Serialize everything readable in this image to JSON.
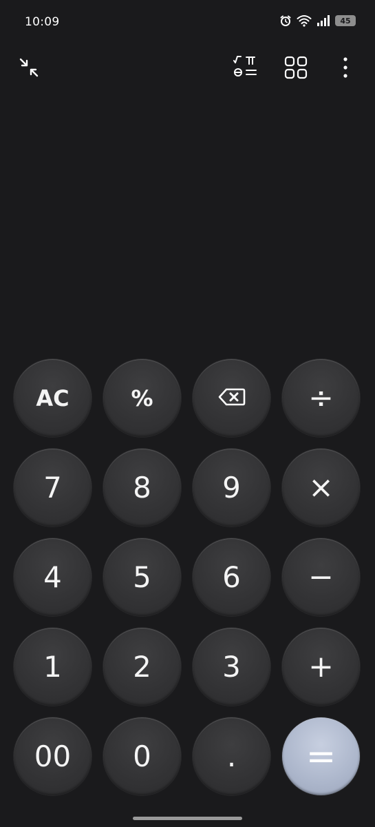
{
  "status_bar": {
    "time": "10:09",
    "battery_level": "45",
    "icons": [
      "alarm-icon",
      "wifi-icon",
      "signal-icon",
      "battery-icon"
    ]
  },
  "toolbar": {
    "collapse_icon": "collapse-icon",
    "scientific_icon": "scientific-mode-icon",
    "converter_icon": "grid-icon",
    "menu_icon": "more-vertical-icon"
  },
  "keys": [
    {
      "label": "AC",
      "name": "clear-button",
      "kind": "fn"
    },
    {
      "label": "%",
      "name": "percent-button",
      "kind": "fn"
    },
    {
      "label": "",
      "name": "backspace-button",
      "kind": "fn",
      "icon": "backspace-icon"
    },
    {
      "label": "÷",
      "name": "divide-button",
      "kind": "op"
    },
    {
      "label": "7",
      "name": "digit-7-button",
      "kind": "num"
    },
    {
      "label": "8",
      "name": "digit-8-button",
      "kind": "num"
    },
    {
      "label": "9",
      "name": "digit-9-button",
      "kind": "num"
    },
    {
      "label": "×",
      "name": "multiply-button",
      "kind": "op"
    },
    {
      "label": "4",
      "name": "digit-4-button",
      "kind": "num"
    },
    {
      "label": "5",
      "name": "digit-5-button",
      "kind": "num"
    },
    {
      "label": "6",
      "name": "digit-6-button",
      "kind": "num"
    },
    {
      "label": "−",
      "name": "subtract-button",
      "kind": "op"
    },
    {
      "label": "1",
      "name": "digit-1-button",
      "kind": "num"
    },
    {
      "label": "2",
      "name": "digit-2-button",
      "kind": "num"
    },
    {
      "label": "3",
      "name": "digit-3-button",
      "kind": "num"
    },
    {
      "label": "+",
      "name": "add-button",
      "kind": "op"
    },
    {
      "label": "00",
      "name": "double-zero-button",
      "kind": "num"
    },
    {
      "label": "0",
      "name": "digit-0-button",
      "kind": "num"
    },
    {
      "label": ".",
      "name": "decimal-point-button",
      "kind": "num"
    },
    {
      "label": "=",
      "name": "equals-button",
      "kind": "equals"
    }
  ],
  "colors": {
    "background": "#1a1a1c",
    "key": "#343436",
    "equals_key": "#aeb8cc",
    "text": "#f4f4f4"
  }
}
